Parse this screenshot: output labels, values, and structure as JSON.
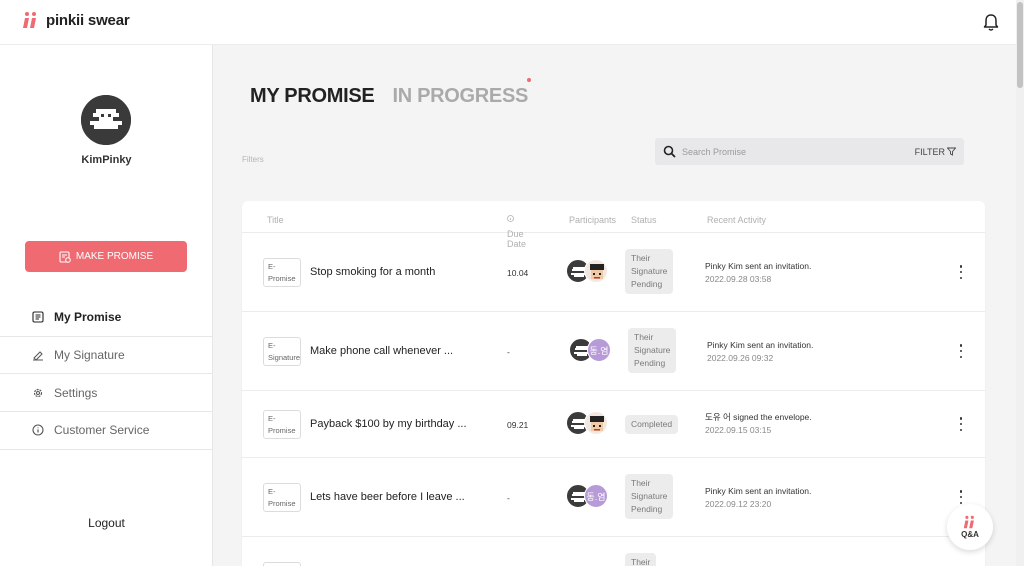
{
  "app": {
    "name": "pinkii swear",
    "accent": "#f06a72"
  },
  "sidebar": {
    "username": "KimPinky",
    "make_button": "MAKE PROMISE",
    "items": [
      {
        "label": "My Promise",
        "icon": "list-icon",
        "active": true
      },
      {
        "label": "My Signature",
        "icon": "signature-icon",
        "active": false
      },
      {
        "label": "Settings",
        "icon": "gear-icon",
        "active": false
      },
      {
        "label": "Customer Service",
        "icon": "info-icon",
        "active": false
      }
    ],
    "logout": "Logout"
  },
  "main": {
    "tabs": [
      {
        "label": "MY PROMISE",
        "active": true
      },
      {
        "label": "IN PROGRESS",
        "active": false,
        "has_dot": true
      }
    ],
    "filters_label": "Filters",
    "search": {
      "placeholder": "Search Promise",
      "value": ""
    },
    "filter_button": "FILTER",
    "table": {
      "columns": [
        "Title",
        "Due Date",
        "Participants",
        "Status",
        "Recent Activity"
      ],
      "rows": [
        {
          "type": [
            "E-",
            "Promise"
          ],
          "title": "Stop smoking for a month",
          "due": "10.04",
          "participants": [
            "avatar-dark",
            "avatar-face"
          ],
          "status": [
            "Their",
            "Signature",
            "Pending"
          ],
          "activity": "Pinky Kim sent an invitation.",
          "time": "2022.09.28 03:58"
        },
        {
          "type": [
            "E-",
            "Signature"
          ],
          "title": "Make phone call whenever ...",
          "due": "-",
          "participants": [
            "avatar-dark",
            "동.염"
          ],
          "status": [
            "Their",
            "Signature",
            "Pending"
          ],
          "activity": "Pinky Kim sent an invitation.",
          "time": "2022.09.26 09:32"
        },
        {
          "type": [
            "E-",
            "Promise"
          ],
          "title": "Payback $100 by my birthday ...",
          "due": "09.21",
          "participants": [
            "avatar-dark",
            "avatar-face"
          ],
          "status": [
            "Completed"
          ],
          "activity": "도유 어 signed the envelope.",
          "time": "2022.09.15 03:15"
        },
        {
          "type": [
            "E-",
            "Promise"
          ],
          "title": "Lets have beer before I leave ...",
          "due": "-",
          "participants": [
            "avatar-dark",
            "동.염"
          ],
          "status": [
            "Their",
            "Signature",
            "Pending"
          ],
          "activity": "Pinky Kim sent an invitation.",
          "time": "2022.09.12 23:20"
        },
        {
          "type": [
            "",
            ""
          ],
          "title": "",
          "due": "",
          "participants": [],
          "status": [
            "Their"
          ],
          "activity": "",
          "time": ""
        }
      ]
    }
  },
  "qa_button": "Q&A"
}
